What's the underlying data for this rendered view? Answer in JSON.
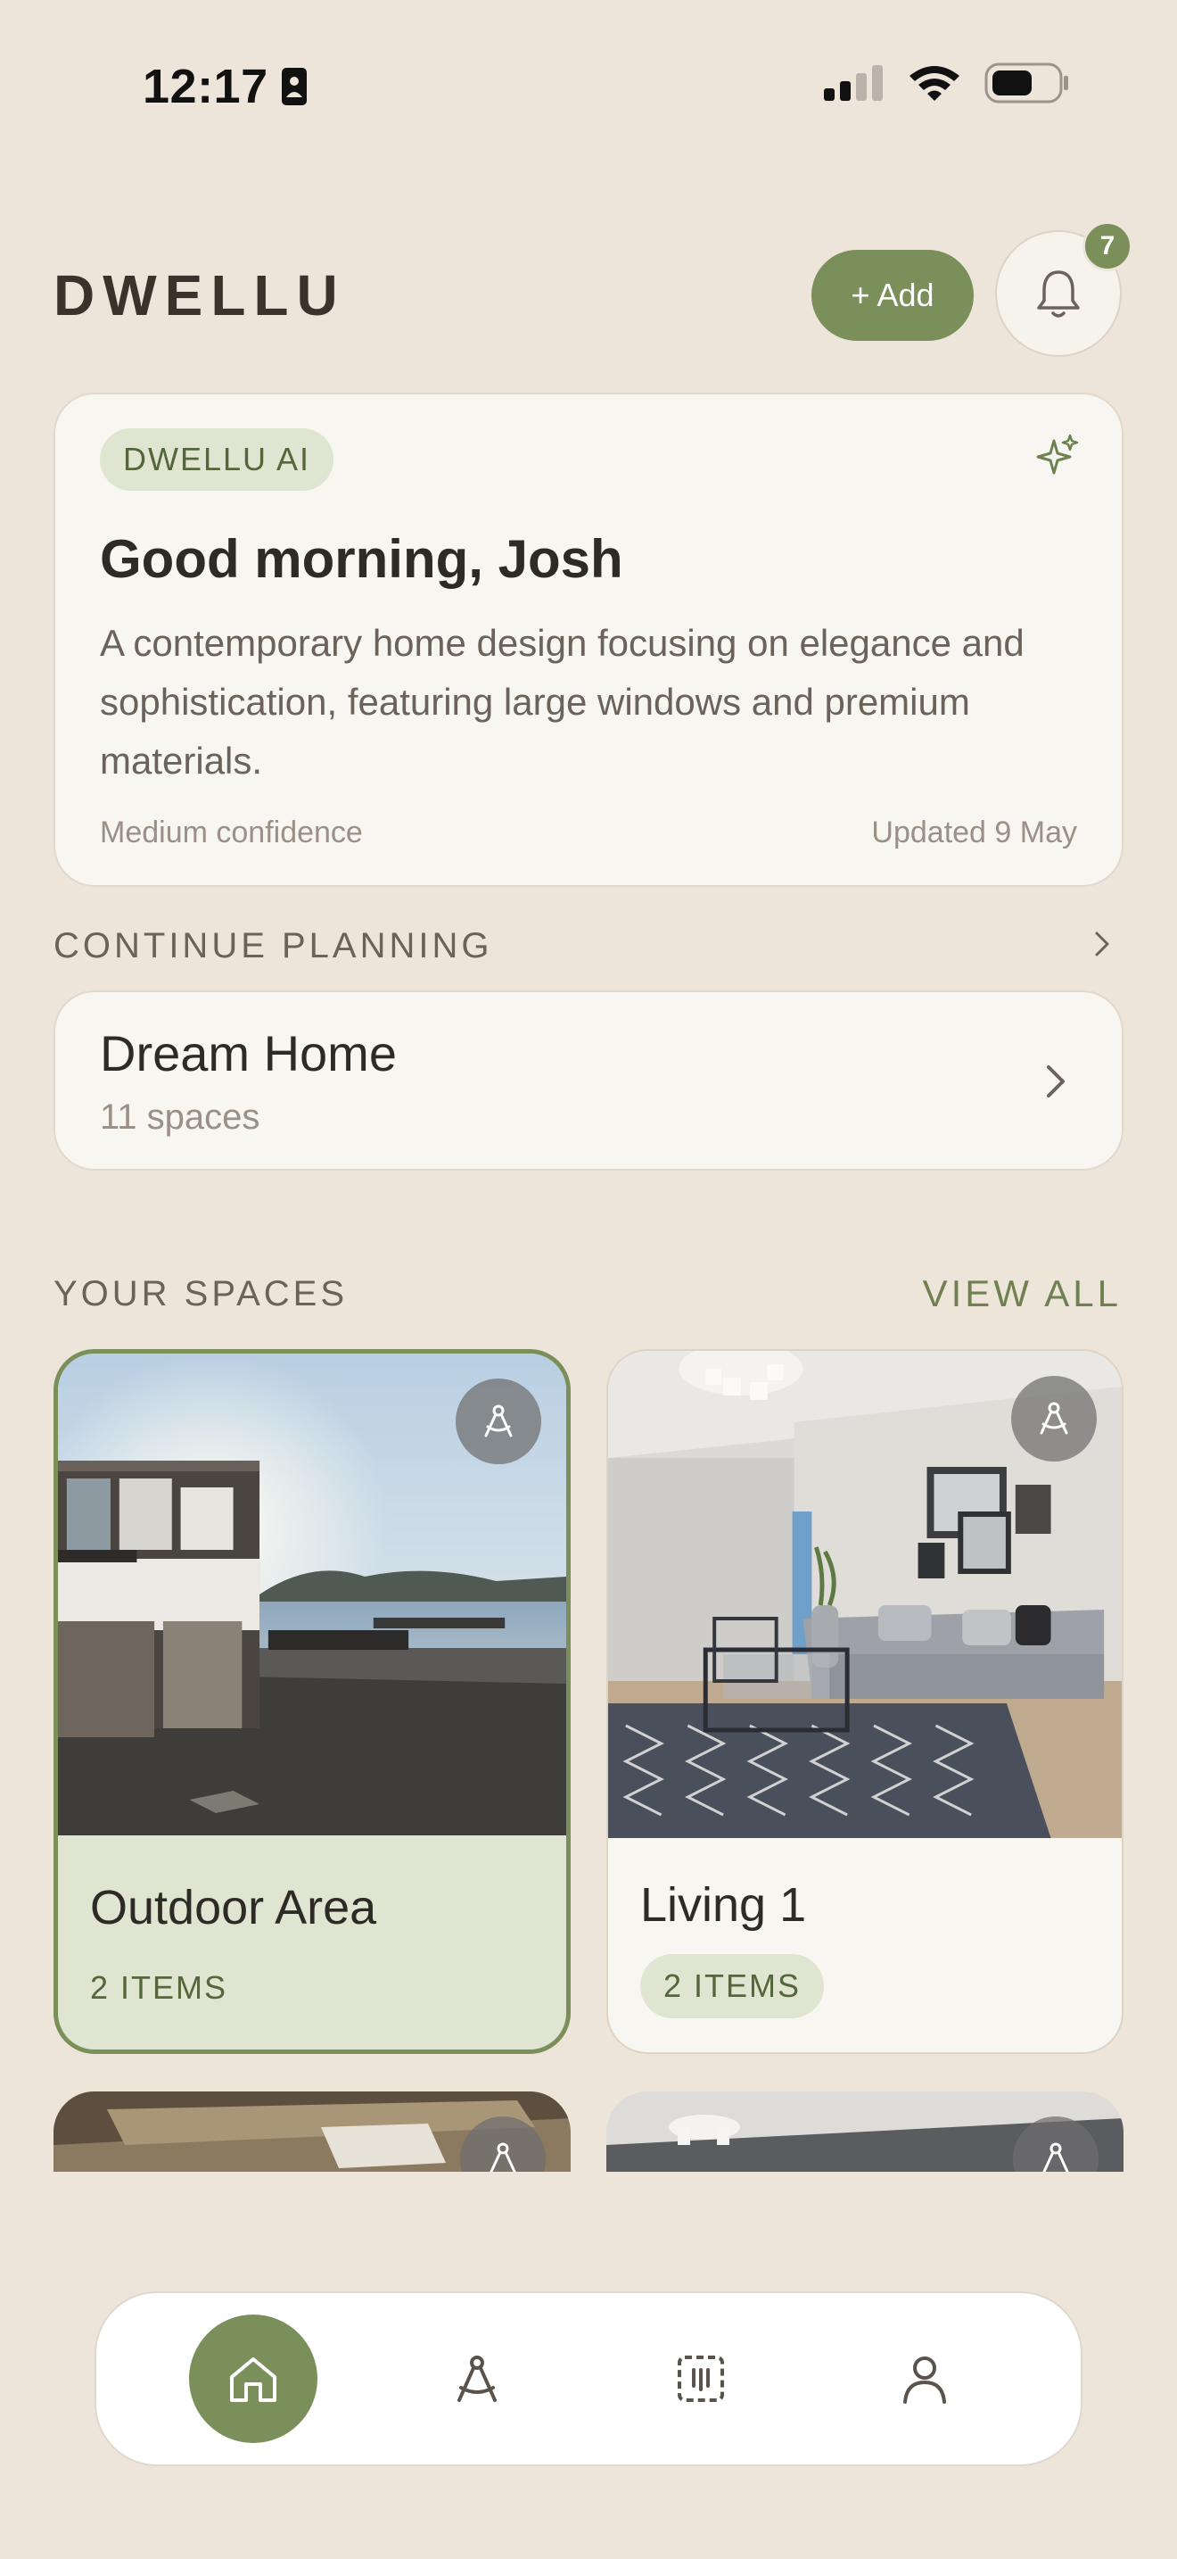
{
  "status_bar": {
    "time": "12:17"
  },
  "header": {
    "logo": "DWELLU",
    "add_label": "+ Add",
    "notification_count": "7"
  },
  "ai_card": {
    "chip": "DWELLU AI",
    "title": "Good morning, Josh",
    "body": "A contemporary home design focusing on elegance and sophistication, featuring large windows and premium materials.",
    "confidence": "Medium confidence",
    "updated": "Updated 9 May"
  },
  "continue_planning": {
    "label": "CONTINUE PLANNING",
    "plan": {
      "title": "Dream Home",
      "subtitle": "11 spaces"
    }
  },
  "spaces": {
    "label": "YOUR SPACES",
    "view_all": "VIEW ALL",
    "items": [
      {
        "name": "Outdoor Area",
        "count": "2 ITEMS",
        "selected": true
      },
      {
        "name": "Living 1",
        "count": "2 ITEMS",
        "selected": false
      }
    ]
  },
  "bottom_nav": {
    "items": [
      {
        "icon": "home-icon",
        "active": true
      },
      {
        "icon": "compass-icon",
        "active": false
      },
      {
        "icon": "scan-icon",
        "active": false
      },
      {
        "icon": "profile-icon",
        "active": false
      }
    ]
  },
  "colors": {
    "accent": "#7a8f5a",
    "background": "#ede5da",
    "card": "#f8f6f1",
    "chip": "#dfe5d0"
  }
}
